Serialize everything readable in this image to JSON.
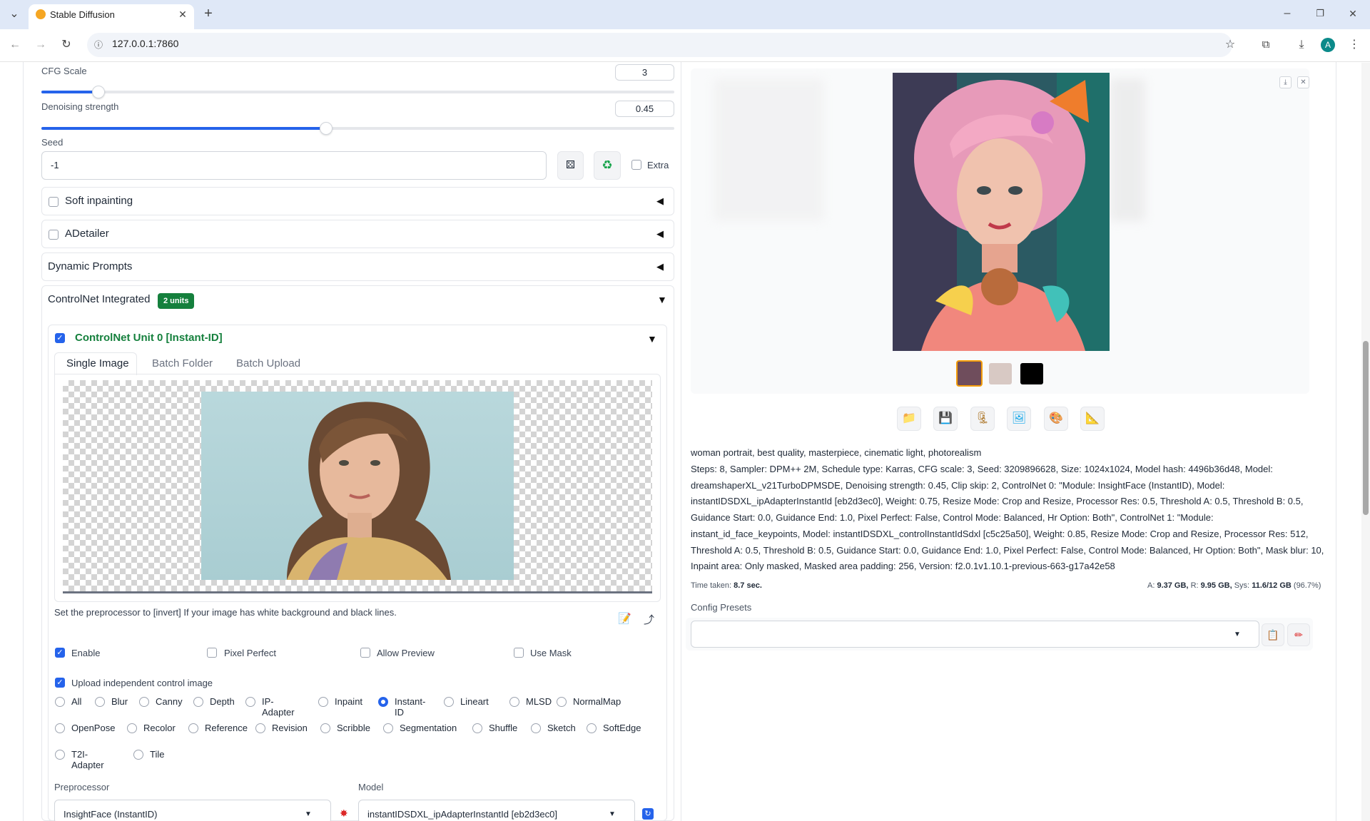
{
  "browser": {
    "tab_title": "Stable Diffusion",
    "url": "127.0.0.1:7860",
    "profile_initial": "A"
  },
  "left": {
    "cfg": {
      "label": "CFG Scale",
      "value": "3",
      "fraction": 0.09
    },
    "denoise": {
      "label": "Denoising strength",
      "value": "0.45",
      "fraction": 0.45
    },
    "seed": {
      "label": "Seed",
      "value": "-1",
      "extra_label": "Extra"
    },
    "accordions": {
      "soft_inpainting": "Soft inpainting",
      "adetailer": "ADetailer",
      "dynamic_prompts": "Dynamic Prompts",
      "controlnet": "ControlNet Integrated",
      "controlnet_badge": "2 units"
    },
    "unit0": {
      "title": "ControlNet Unit 0 [Instant-ID]",
      "tabs": [
        "Single Image",
        "Batch Folder",
        "Batch Upload"
      ],
      "hint": "Set the preprocessor to [invert] If your image has white background and black lines.",
      "options": {
        "enable": "Enable",
        "pixel_perfect": "Pixel Perfect",
        "allow_preview": "Allow Preview",
        "use_mask": "Use Mask",
        "upload_independent": "Upload independent control image"
      },
      "control_types_row1": [
        "All",
        "Blur",
        "Canny",
        "Depth",
        "IP-Adapter",
        "Inpaint",
        "Instant-ID",
        "Lineart",
        "MLSD",
        "NormalMap"
      ],
      "control_types_row2": [
        "OpenPose",
        "Recolor",
        "Reference",
        "Revision",
        "Scribble",
        "Segmentation",
        "Shuffle",
        "Sketch",
        "SoftEdge"
      ],
      "control_types_row3": [
        "T2I-Adapter",
        "Tile"
      ],
      "selected_type": "Instant-ID",
      "preprocessor_label": "Preprocessor",
      "preprocessor_value": "InsightFace (InstantID)",
      "model_label": "Model",
      "model_value": "instantIDSDXL_ipAdapterInstantId [eb2d3ec0]"
    }
  },
  "right": {
    "prompt": "woman portrait, best quality, masterpiece, cinematic light, photorealism",
    "info_lines": [
      "Steps: 8, Sampler: DPM++ 2M, Schedule type: Karras, CFG scale: 3, Seed: 3209896628, Size: 1024x1024, Model hash: 4496b36d48, Model:",
      "dreamshaperXL_v21TurboDPMSDE, Denoising strength: 0.45, Clip skip: 2, ControlNet 0: \"Module: InsightFace (InstantID), Model:",
      "instantIDSDXL_ipAdapterInstantId [eb2d3ec0], Weight: 0.75, Resize Mode: Crop and Resize, Processor Res: 0.5, Threshold A: 0.5, Threshold B: 0.5,",
      "Guidance Start: 0.0, Guidance End: 1.0, Pixel Perfect: False, Control Mode: Balanced, Hr Option: Both\", ControlNet 1: \"Module:",
      "instant_id_face_keypoints, Model: instantIDSDXL_controlInstantIdSdxl [c5c25a50], Weight: 0.85, Resize Mode: Crop and Resize, Processor Res: 512,",
      "Threshold A: 0.5, Threshold B: 0.5, Guidance Start: 0.0, Guidance End: 1.0, Pixel Perfect: False, Control Mode: Balanced, Hr Option: Both\", Mask blur: 10,",
      "Inpaint area: Only masked, Masked area padding: 256, Version: f2.0.1v1.10.1-previous-663-g17a42e58"
    ],
    "time_label": "Time taken:",
    "time_value": "8.7 sec.",
    "mem_a_label": "A:",
    "mem_a": "9.37 GB,",
    "mem_r_label": "R:",
    "mem_r": "9.95 GB,",
    "mem_sys_label": "Sys:",
    "mem_sys": "11.6/12 GB",
    "mem_pct": "(96.7%)",
    "config_presets_label": "Config Presets",
    "icons": [
      "folder-icon",
      "save-icon",
      "zip-icon",
      "send-to-img2img-icon",
      "send-to-inpaint-icon",
      "send-to-extras-icon"
    ]
  }
}
